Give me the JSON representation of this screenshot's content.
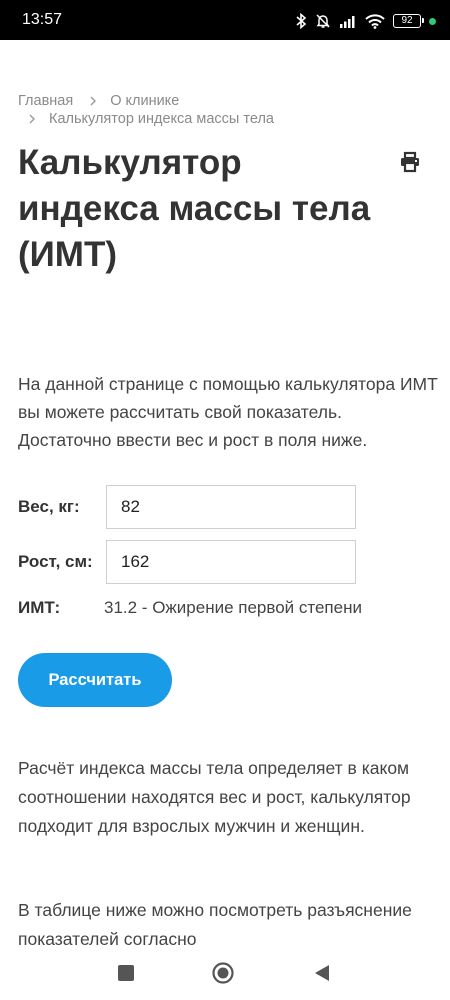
{
  "status_bar": {
    "time": "13:57",
    "battery": "92",
    "icons": [
      "bluetooth-icon",
      "bell-off-icon",
      "signal-icon",
      "wifi-icon",
      "battery-icon",
      "notification-dot"
    ]
  },
  "breadcrumb": {
    "items": [
      "Главная",
      "О клинике",
      "Калькулятор индекса массы тела"
    ]
  },
  "page": {
    "title": "Калькулятор индекса массы тела (ИМТ)",
    "print_icon": "printer-icon",
    "intro": "На данной странице с помощью калькулятора ИМТ вы можете рассчитать свой показатель. Достаточно ввести вес и рост в поля ниже."
  },
  "form": {
    "weight_label": "Вес, кг:",
    "weight_value": "82",
    "height_label": "Рост, см:",
    "height_value": "162",
    "bmi_label": "ИМТ:",
    "bmi_result": "31.2 - Ожирение первой степени",
    "button_label": "Рассчитать"
  },
  "content": {
    "paragraph1": "Расчёт индекса массы тела определяет в каком соотношении находятся вес и рост, калькулятор подходит для взрослых мужчин и женщин.",
    "paragraph2": "В таблице ниже можно посмотреть разъяснение показателей согласно"
  },
  "nav_bar": {
    "icons": [
      "recents-square-icon",
      "home-circle-icon",
      "back-triangle-icon"
    ]
  },
  "colors": {
    "accent": "#1a9be8",
    "status_dot": "#2ecc71",
    "text": "#333333",
    "muted": "#8a8a8a"
  }
}
